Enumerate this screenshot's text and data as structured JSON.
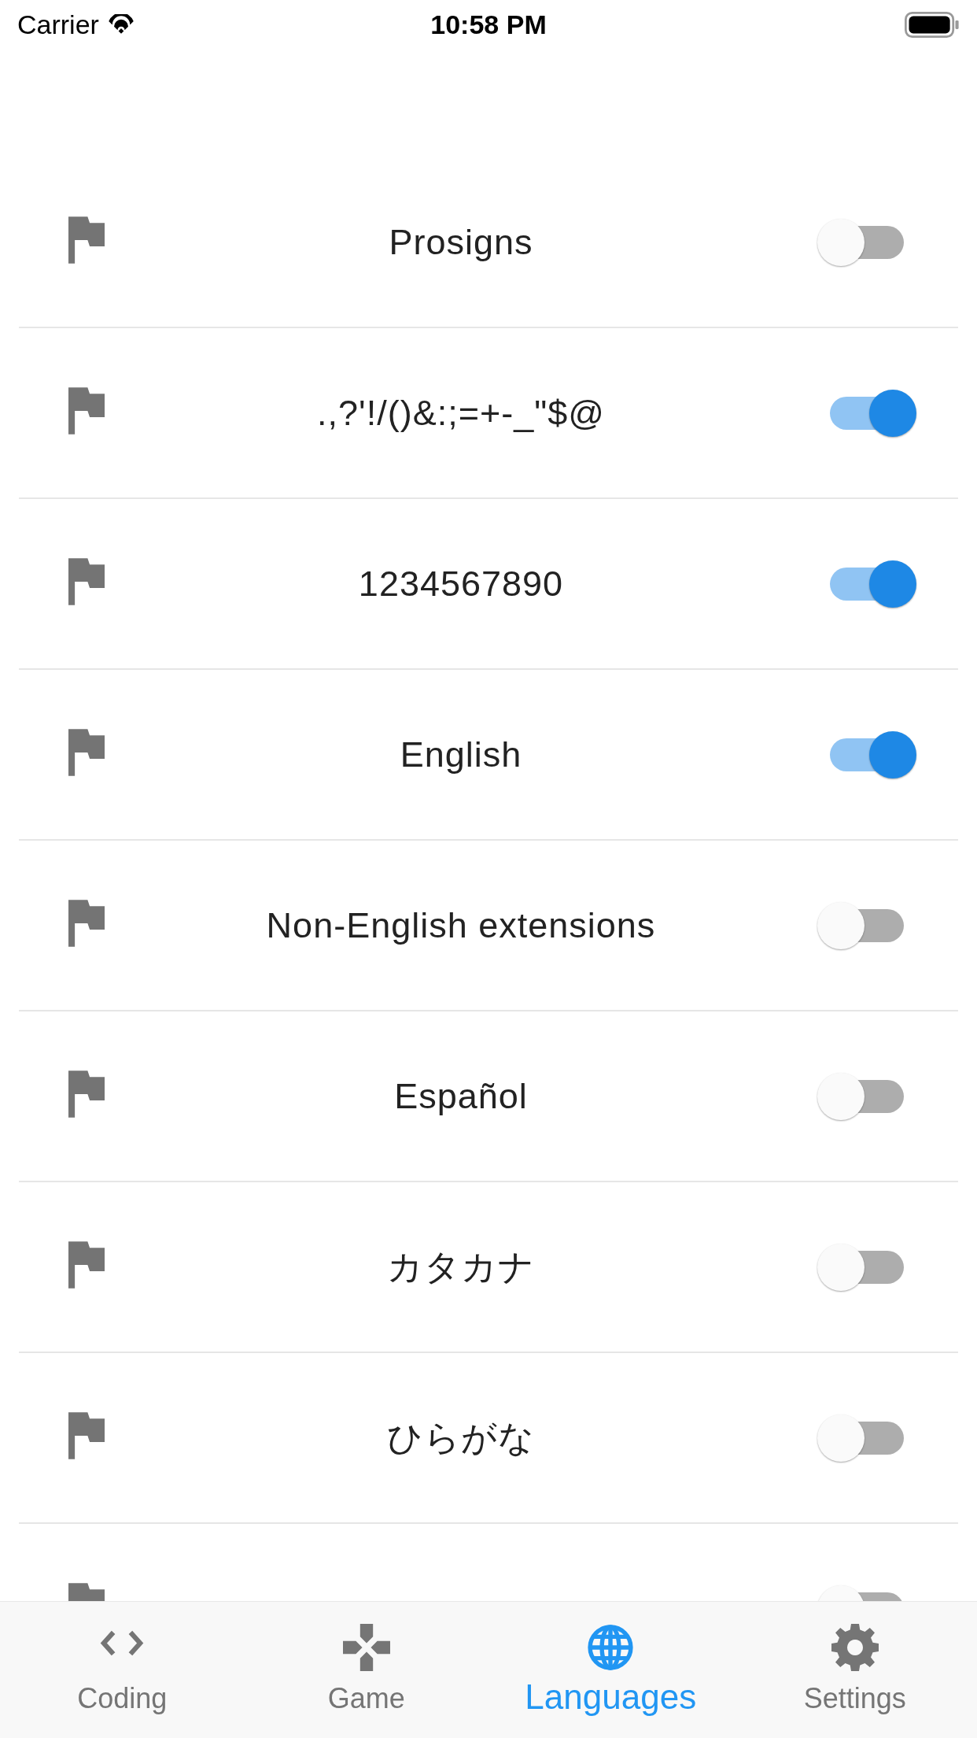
{
  "status_bar": {
    "carrier": "Carrier",
    "time": "10:58 PM"
  },
  "languages": [
    {
      "label": "Prosigns",
      "on": false
    },
    {
      "label": ".,?'!/()&:;=+-_\"$@",
      "on": true
    },
    {
      "label": "1234567890",
      "on": true
    },
    {
      "label": "English",
      "on": true
    },
    {
      "label": "Non-English extensions",
      "on": false
    },
    {
      "label": "Español",
      "on": false
    },
    {
      "label": "カタカナ",
      "on": false
    },
    {
      "label": "ひらがな",
      "on": false
    },
    {
      "on": false
    }
  ],
  "tab_bar": [
    {
      "kind": "code",
      "label": "Coding",
      "selected": false
    },
    {
      "kind": "game",
      "label": "Game",
      "selected": false
    },
    {
      "kind": "globe",
      "label": "Languages",
      "selected": true
    },
    {
      "kind": "gear",
      "label": "Settings",
      "selected": false
    }
  ]
}
